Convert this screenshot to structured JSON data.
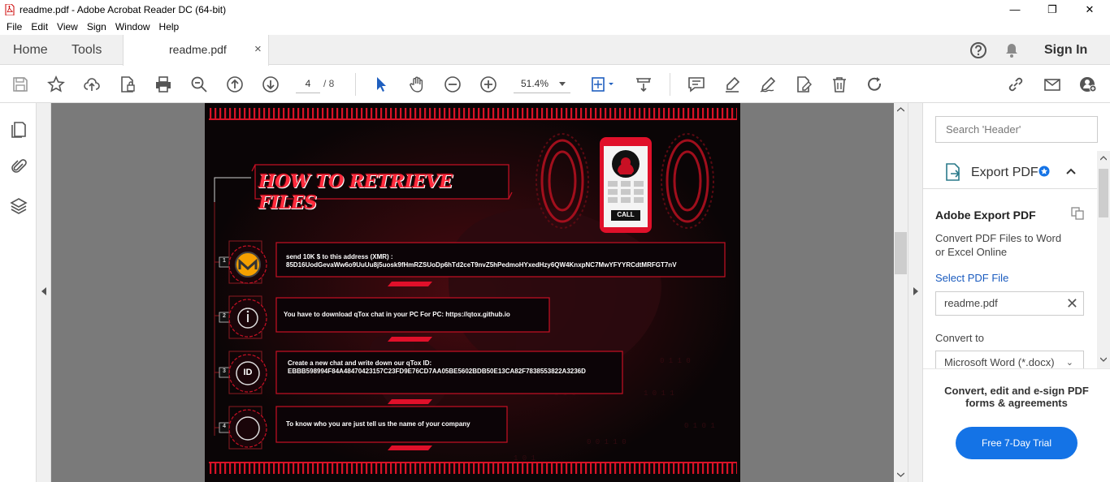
{
  "window": {
    "title": "readme.pdf - Adobe Acrobat Reader DC (64-bit)",
    "minimize": "—",
    "restore": "❐",
    "close": "✕"
  },
  "menu": [
    "File",
    "Edit",
    "View",
    "Sign",
    "Window",
    "Help"
  ],
  "tabs": {
    "home": "Home",
    "tools": "Tools",
    "document": "readme.pdf",
    "close": "×",
    "sign_in": "Sign In"
  },
  "toolbar": {
    "page_current": "4",
    "page_total": "/ 8",
    "zoom": "51.4%"
  },
  "document": {
    "heading": "HOW TO RETRIEVE FILES",
    "call_label": "CALL",
    "steps": [
      {
        "number": "1",
        "icon": "monero-icon",
        "line1": "send 10K $ to this address (XMR) :",
        "line2": "85D16UodGevaWw6o9UuUu8j5uosk9fHmRZSUoDp6hTd2ceT9nvZ5hPedmoHYxedHzy6QW4KnxpNC7MwYFYYRCdtMRFGT7nV"
      },
      {
        "number": "2",
        "icon": "info-icon",
        "line1": "You have to download qTox chat in your PC For PC: https://qtox.github.io",
        "line2": ""
      },
      {
        "number": "3",
        "icon": "id-icon",
        "icon_text": "ID",
        "line1": "Create a new chat and write down our qTox ID:",
        "line2": "EBBB598994F84A48470423157C23FD9E76CD7AA05BE5602BDB50E13CA82F7838553822A3236D"
      },
      {
        "number": "4",
        "icon": "circle-icon",
        "line1": "To know who you are just tell us the name of your company",
        "line2": ""
      }
    ]
  },
  "right_panel": {
    "search_placeholder": "Search 'Header'",
    "export_title": "Export PDF",
    "export_heading": "Adobe Export PDF",
    "export_desc": "Convert PDF Files to Word or Excel Online",
    "select_label": "Select PDF File",
    "file_name": "readme.pdf",
    "convert_label": "Convert to",
    "format": "Microsoft Word (*.docx)",
    "promo": "Convert, edit and e-sign PDF forms & agreements",
    "trial_button": "Free 7-Day Trial"
  },
  "colors": {
    "accent": "#1473e6",
    "poster_red": "#e0102a",
    "poster_bg": "#0a0506"
  }
}
